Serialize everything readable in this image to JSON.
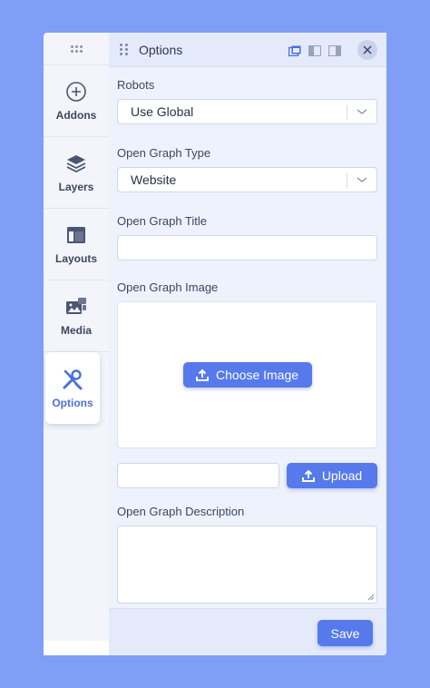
{
  "sidebar": {
    "items": [
      {
        "label": "Addons",
        "icon": "plus-circle-icon"
      },
      {
        "label": "Layers",
        "icon": "layers-icon"
      },
      {
        "label": "Layouts",
        "icon": "layout-icon"
      },
      {
        "label": "Media",
        "icon": "media-icon"
      },
      {
        "label": "Options",
        "icon": "tools-icon",
        "active": true
      }
    ]
  },
  "panel": {
    "title": "Options",
    "fields": {
      "robots": {
        "label": "Robots",
        "value": "Use Global"
      },
      "og_type": {
        "label": "Open Graph Type",
        "value": "Website"
      },
      "og_title": {
        "label": "Open Graph Title",
        "value": ""
      },
      "og_image": {
        "label": "Open Graph Image",
        "choose_label": "Choose Image",
        "url_value": "",
        "upload_label": "Upload"
      },
      "og_description": {
        "label": "Open Graph Description",
        "value": ""
      }
    },
    "save_label": "Save"
  },
  "colors": {
    "background": "#809ef5",
    "accent": "#5679ec",
    "panel": "#eef2fc"
  }
}
